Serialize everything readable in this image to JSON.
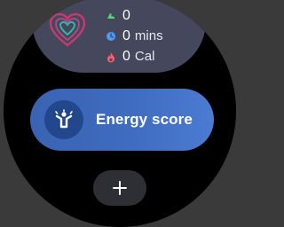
{
  "stats": {
    "steps": {
      "value": "0",
      "icon": "shoe-icon",
      "color": "#4cd964"
    },
    "active_time": {
      "value": "0",
      "unit": "mins",
      "icon": "clock-icon",
      "color": "#4a9cf5"
    },
    "calories": {
      "value": "0",
      "unit": "Cal",
      "icon": "flame-icon",
      "color": "#ff5a6e"
    }
  },
  "heart_icon": {
    "name": "heart-icon",
    "colors": [
      "#c33a6e",
      "#2fb8a6"
    ]
  },
  "energy": {
    "label": "Energy score",
    "icon": "person-arms-up-icon",
    "color": "#3f6cc0"
  },
  "add_button": {
    "label": "+",
    "icon": "plus-icon"
  }
}
